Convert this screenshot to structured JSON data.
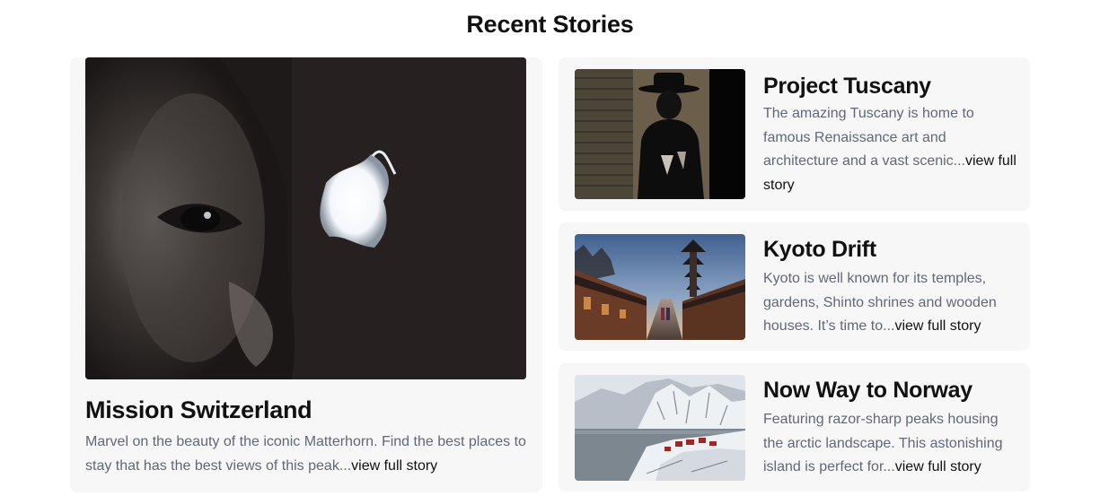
{
  "section": {
    "title": "Recent Stories"
  },
  "featured": {
    "image_icon": "person-peering-through-hole-photo",
    "title": "Mission Switzerland",
    "description": "Marvel on the beauty of the iconic Matterhorn. Find the best places to stay that has the best views of this peak...",
    "link_label": "view full story"
  },
  "stories": [
    {
      "image_icon": "man-in-hat-shadow-photo",
      "title": "Project Tuscany",
      "description": "The amazing Tuscany is home to famous Renaissance art and architecture and a vast scenic...",
      "link_label": "view full story"
    },
    {
      "image_icon": "kyoto-street-pagoda-photo",
      "title": "Kyoto Drift",
      "description": "Kyoto is well known for its temples, gardens, Shinto shrines and wooden houses. It’s time to...",
      "link_label": "view full story"
    },
    {
      "image_icon": "snowy-norway-fjord-photo",
      "title": "Now Way to Norway",
      "description": "Featuring razor-sharp peaks housing the arctic landscape. This astonishing island is perfect for...",
      "link_label": "view full story"
    }
  ],
  "colors": {
    "card_background": "#f7f7f8",
    "title": "#111111",
    "description": "#606877",
    "link": "#111111"
  }
}
